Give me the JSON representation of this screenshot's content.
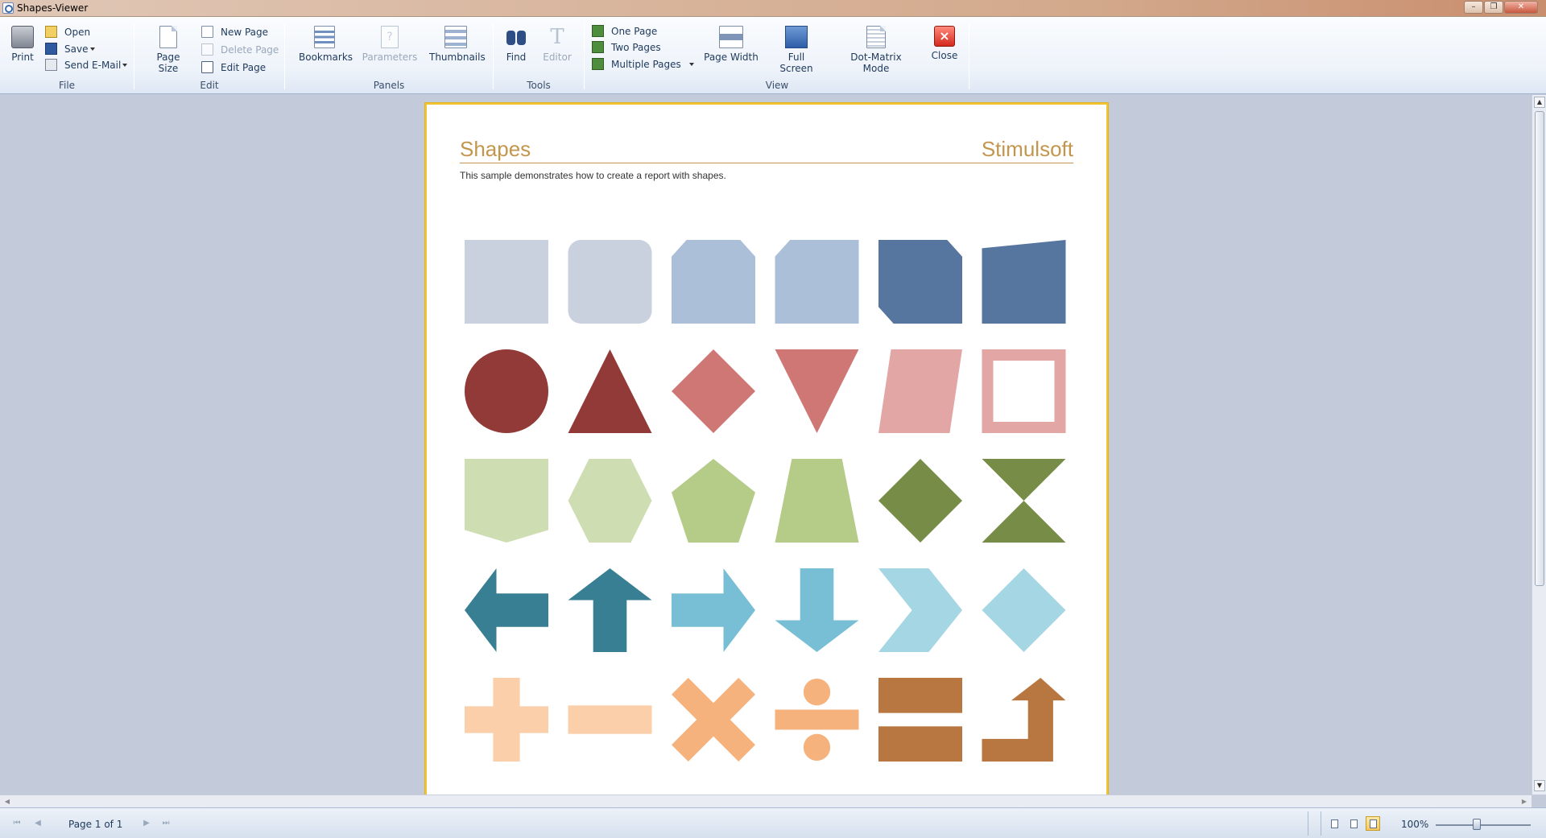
{
  "window": {
    "title": "Shapes-Viewer"
  },
  "ribbon": {
    "groups": {
      "file": "File",
      "edit": "Edit",
      "panels": "Panels",
      "tools": "Tools",
      "view": "View"
    },
    "file": {
      "print": "Print",
      "open": "Open",
      "save": "Save",
      "send_email": "Send E-Mail"
    },
    "edit": {
      "page_size": "Page Size",
      "new_page": "New Page",
      "delete_page": "Delete Page",
      "edit_page": "Edit Page"
    },
    "panels": {
      "bookmarks": "Bookmarks",
      "parameters": "Parameters",
      "thumbnails": "Thumbnails"
    },
    "tools": {
      "find": "Find",
      "editor": "Editor"
    },
    "view": {
      "one_page": "One Page",
      "two_pages": "Two Pages",
      "multiple_pages": "Multiple Pages",
      "page_width": "Page Width",
      "full_screen": "Full Screen",
      "dot_matrix": "Dot-Matrix Mode",
      "close": "Close"
    }
  },
  "report": {
    "title": "Shapes",
    "brand": "Stimulsoft",
    "description": "This sample demonstrates how to create a report with shapes.",
    "colors": {
      "grey_blue_light": "#c8d1dd",
      "blue_mid": "#abbfd8",
      "blue_dark": "#56759f",
      "red_dark": "#913a37",
      "red_mid": "#cf7775",
      "pink": "#e2a6a5",
      "green_light": "#cfdeb2",
      "green_mid": "#b5cc88",
      "green_dark": "#778c47",
      "teal_dark": "#387f93",
      "teal_mid": "#78bfd5",
      "teal_light": "#a5d6e3",
      "peach": "#fbcfaa",
      "orange": "#f5b27c",
      "brown": "#b87641"
    }
  },
  "status": {
    "page_info": "Page 1 of 1",
    "zoom": "100%"
  }
}
